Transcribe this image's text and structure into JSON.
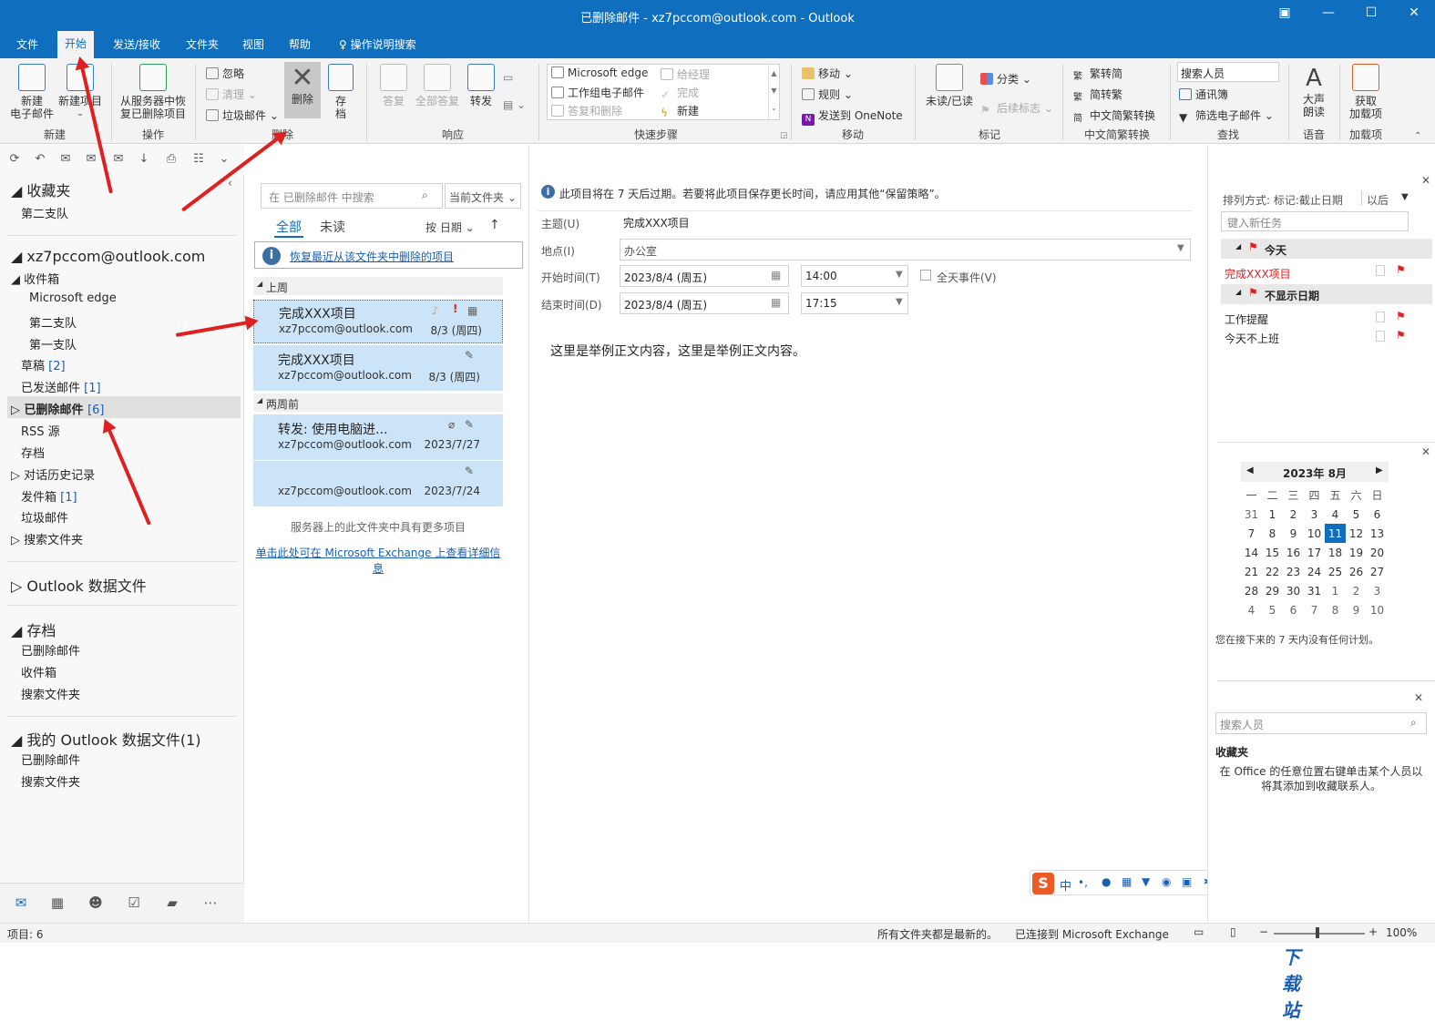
{
  "title": "已删除邮件 - xz7pccom@outlook.com  -  Outlook",
  "ribbon_tabs": [
    "文件",
    "开始",
    "发送/接收",
    "文件夹",
    "视图",
    "帮助"
  ],
  "tell_me": "操作说明搜索",
  "ribbon": {
    "new_email": "新建\n电子邮件",
    "new_items": "新建项目",
    "group_new": "新建",
    "recover": "从服务器中恢\n复已删除项目",
    "group_actions": "操作",
    "ignore": "忽略",
    "cleanup": "清理",
    "junk": "垃圾邮件",
    "delete": "删除",
    "archive": "存\n档",
    "group_delete": "删除",
    "reply": "答复",
    "reply_all": "全部答复",
    "forward": "转发",
    "group_respond": "响应",
    "qs_items": [
      "Microsoft edge",
      "工作组电子邮件",
      "答复和删除",
      "给经理",
      "完成",
      "新建"
    ],
    "group_quicksteps": "快速步骤",
    "move": "移动",
    "rules": "规则",
    "onenote": "发送到 OneNote",
    "group_move": "移动",
    "unread_read": "未读/已读",
    "categorize": "分类",
    "followup": "后续标志",
    "group_tags": "标记",
    "trad": "繁转简",
    "simp": "简转繁",
    "conv": "中文简繁转换",
    "group_conv": "中文简繁转换",
    "search_people": "搜索人员",
    "address_book": "通讯簿",
    "filter_email": "筛选电子邮件",
    "group_find": "查找",
    "read_aloud": "大声\n朗读",
    "group_voice": "语音",
    "get_addins": "获取\n加载项",
    "group_addins": "加载项"
  },
  "folders": {
    "favorites": "收藏夹",
    "fav_items": [
      "第二支队"
    ],
    "account": "xz7pccom@outlook.com",
    "inbox": "收件箱",
    "inbox_sub": [
      "Microsoft edge",
      "第二支队",
      "第一支队"
    ],
    "drafts": "草稿",
    "drafts_count": "[2]",
    "sent": "已发送邮件",
    "sent_count": "[1]",
    "deleted": "已删除邮件",
    "deleted_count": "[6]",
    "rss": "RSS 源",
    "archive": "存档",
    "conv_history": "对话历史记录",
    "outbox": "发件箱",
    "outbox_count": "[1]",
    "junk": "垃圾邮件",
    "search_folders": "搜索文件夹",
    "outlook_data": "Outlook 数据文件",
    "archive_root": "存档",
    "archive_items": [
      "已删除邮件",
      "收件箱",
      "搜索文件夹"
    ],
    "my_data": "我的 Outlook 数据文件(1)",
    "my_data_items": [
      "已删除邮件",
      "搜索文件夹"
    ]
  },
  "list": {
    "search_placeholder": "在 已删除邮件 中搜索",
    "scope": "当前文件夹",
    "filter_all": "全部",
    "filter_unread": "未读",
    "sort": "按 日期",
    "recover_link": "恢复最近从该文件夹中删除的项目",
    "group_last_week": "上周",
    "group_two_weeks": "两周前",
    "messages": [
      {
        "subject": "完成XXX项目",
        "from": "xz7pccom@outlook.com",
        "date": "8/3 (周四)"
      },
      {
        "subject": "完成XXX项目",
        "from": "xz7pccom@outlook.com",
        "date": "8/3 (周四)"
      },
      {
        "subject": "转发:      使用电脑进...",
        "from": "xz7pccom@outlook.com",
        "date": "2023/7/27"
      },
      {
        "subject": "",
        "from": "xz7pccom@outlook.com",
        "date": "2023/7/24"
      }
    ],
    "more_items": "服务器上的此文件夹中具有更多项目",
    "exchange_link": "单击此处可在 Microsoft Exchange 上查看详细信息"
  },
  "reading": {
    "info": "此项目将在 7 天后过期。若要将此项目保存更长时间，请应用其他“保留策略”。",
    "subject_label": "主题(U)",
    "subject": "完成XXX项目",
    "location_label": "地点(I)",
    "location": "办公室",
    "start_label": "开始时间(T)",
    "start_date": "2023/8/4 (周五)",
    "start_time": "14:00",
    "allday": "全天事件(V)",
    "end_label": "结束时间(D)",
    "end_date": "2023/8/4 (周五)",
    "end_time": "17:15",
    "body": "这里是举例正文内容，这里是举例正文内容。"
  },
  "todo": {
    "sort_label": "排列方式: 标记:截止日期",
    "sort_dir": "以后",
    "new_task": "键入新任务",
    "today": "今天",
    "today_items": [
      "完成XXX项目"
    ],
    "nodate": "不显示日期",
    "nodate_items": [
      "工作提醒",
      "今天不上班"
    ],
    "cal_title": "2023年 8月",
    "weekdays": [
      "一",
      "二",
      "三",
      "四",
      "五",
      "六",
      "日"
    ],
    "weeks": [
      [
        "31",
        "1",
        "2",
        "3",
        "4",
        "5",
        "6"
      ],
      [
        "7",
        "8",
        "9",
        "10",
        "11",
        "12",
        "13"
      ],
      [
        "14",
        "15",
        "16",
        "17",
        "18",
        "19",
        "20"
      ],
      [
        "21",
        "22",
        "23",
        "24",
        "25",
        "26",
        "27"
      ],
      [
        "28",
        "29",
        "30",
        "31",
        "1",
        "2",
        "3"
      ],
      [
        "4",
        "5",
        "6",
        "7",
        "8",
        "9",
        "10"
      ]
    ],
    "cal_note": "您在接下来的 7 天内没有任何计划。",
    "people_search": "搜索人员",
    "people_fav": "收藏夹",
    "people_note": "在 Office 的任意位置右键单击某个人员以将其添加到收藏联系人。"
  },
  "status": {
    "items": "项目: 6",
    "all_updated": "所有文件夹都是最新的。",
    "connected": "已连接到 Microsoft Exchange",
    "zoom": "100%"
  },
  "ime": [
    "中",
    "•,"
  ],
  "watermark": "极光下载站",
  "colors": {
    "accent": "#106ebe",
    "selected": "#cce4f7",
    "annotation": "#e02020",
    "today_task": "#e02020"
  }
}
